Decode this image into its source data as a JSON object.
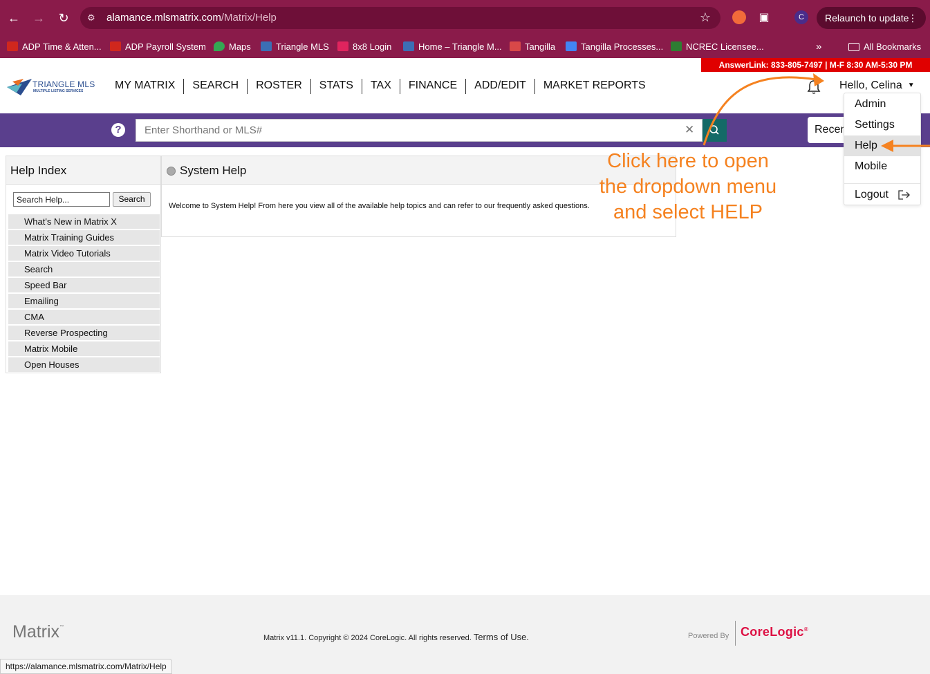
{
  "browser": {
    "url_host": "alamance.mlsmatrix.com",
    "url_path": "/Matrix/Help",
    "profile_initial": "C",
    "relaunch_label": "Relaunch to update",
    "bookmarks": [
      {
        "label": "ADP Time & Atten...",
        "color": "#d0271d"
      },
      {
        "label": "ADP Payroll System",
        "color": "#d0271d"
      },
      {
        "label": "Maps",
        "color": "#34a853"
      },
      {
        "label": "Triangle MLS",
        "color": "#3b6fb5"
      },
      {
        "label": "8x8 Login",
        "color": "#e0245e"
      },
      {
        "label": "Home – Triangle M...",
        "color": "#3b6fb5"
      },
      {
        "label": "Tangilla",
        "color": "#d94848"
      },
      {
        "label": "Tangilla Processes...",
        "color": "#4285f4"
      },
      {
        "label": "NCREC Licensee...",
        "color": "#2e7d32"
      }
    ],
    "all_bookmarks_label": "All Bookmarks",
    "status_url": "https://alamance.mlsmatrix.com/Matrix/Help"
  },
  "header": {
    "answerlink": "AnswerLink: 833-805-7497 | M-F 8:30 AM-5:30 PM",
    "logo_brand": "TRIANGLE MLS",
    "logo_sub": "MULTIPLE LISTING SERVICES",
    "nav": [
      "MY MATRIX",
      "SEARCH",
      "ROSTER",
      "STATS",
      "TAX",
      "FINANCE",
      "ADD/EDIT",
      "MARKET REPORTS"
    ],
    "greeting": "Hello, Celina"
  },
  "searchbar": {
    "placeholder": "Enter Shorthand or MLS#",
    "recent_label": "Recent"
  },
  "user_dropdown": {
    "items": [
      "Admin",
      "Settings",
      "Help",
      "Mobile"
    ],
    "logout": "Logout",
    "active": "Help"
  },
  "help_index": {
    "title": "Help Index",
    "search_value": "Search Help...",
    "search_button": "Search",
    "items": [
      "What's New in Matrix X",
      "Matrix Training Guides",
      "Matrix Video Tutorials",
      "Search",
      "Speed Bar",
      "Emailing",
      "CMA",
      "Reverse Prospecting",
      "Matrix Mobile",
      "Open Houses"
    ]
  },
  "system_help": {
    "title": "System Help",
    "body": "Welcome to System Help! From here you view all of the available help topics and can refer to our frequently asked questions."
  },
  "annotation": {
    "lines": [
      "Click here to open",
      "the dropdown menu",
      "and select HELP"
    ],
    "color": "#f58220"
  },
  "footer": {
    "logo": "Matrix",
    "tm": "™",
    "copyright": "Matrix v11.1. Copyright © 2024 CoreLogic. All rights reserved.",
    "terms": "Terms of Use.",
    "powered_by": "Powered By",
    "corelogic": "CoreLogic",
    "corelogic_mark": "®"
  }
}
